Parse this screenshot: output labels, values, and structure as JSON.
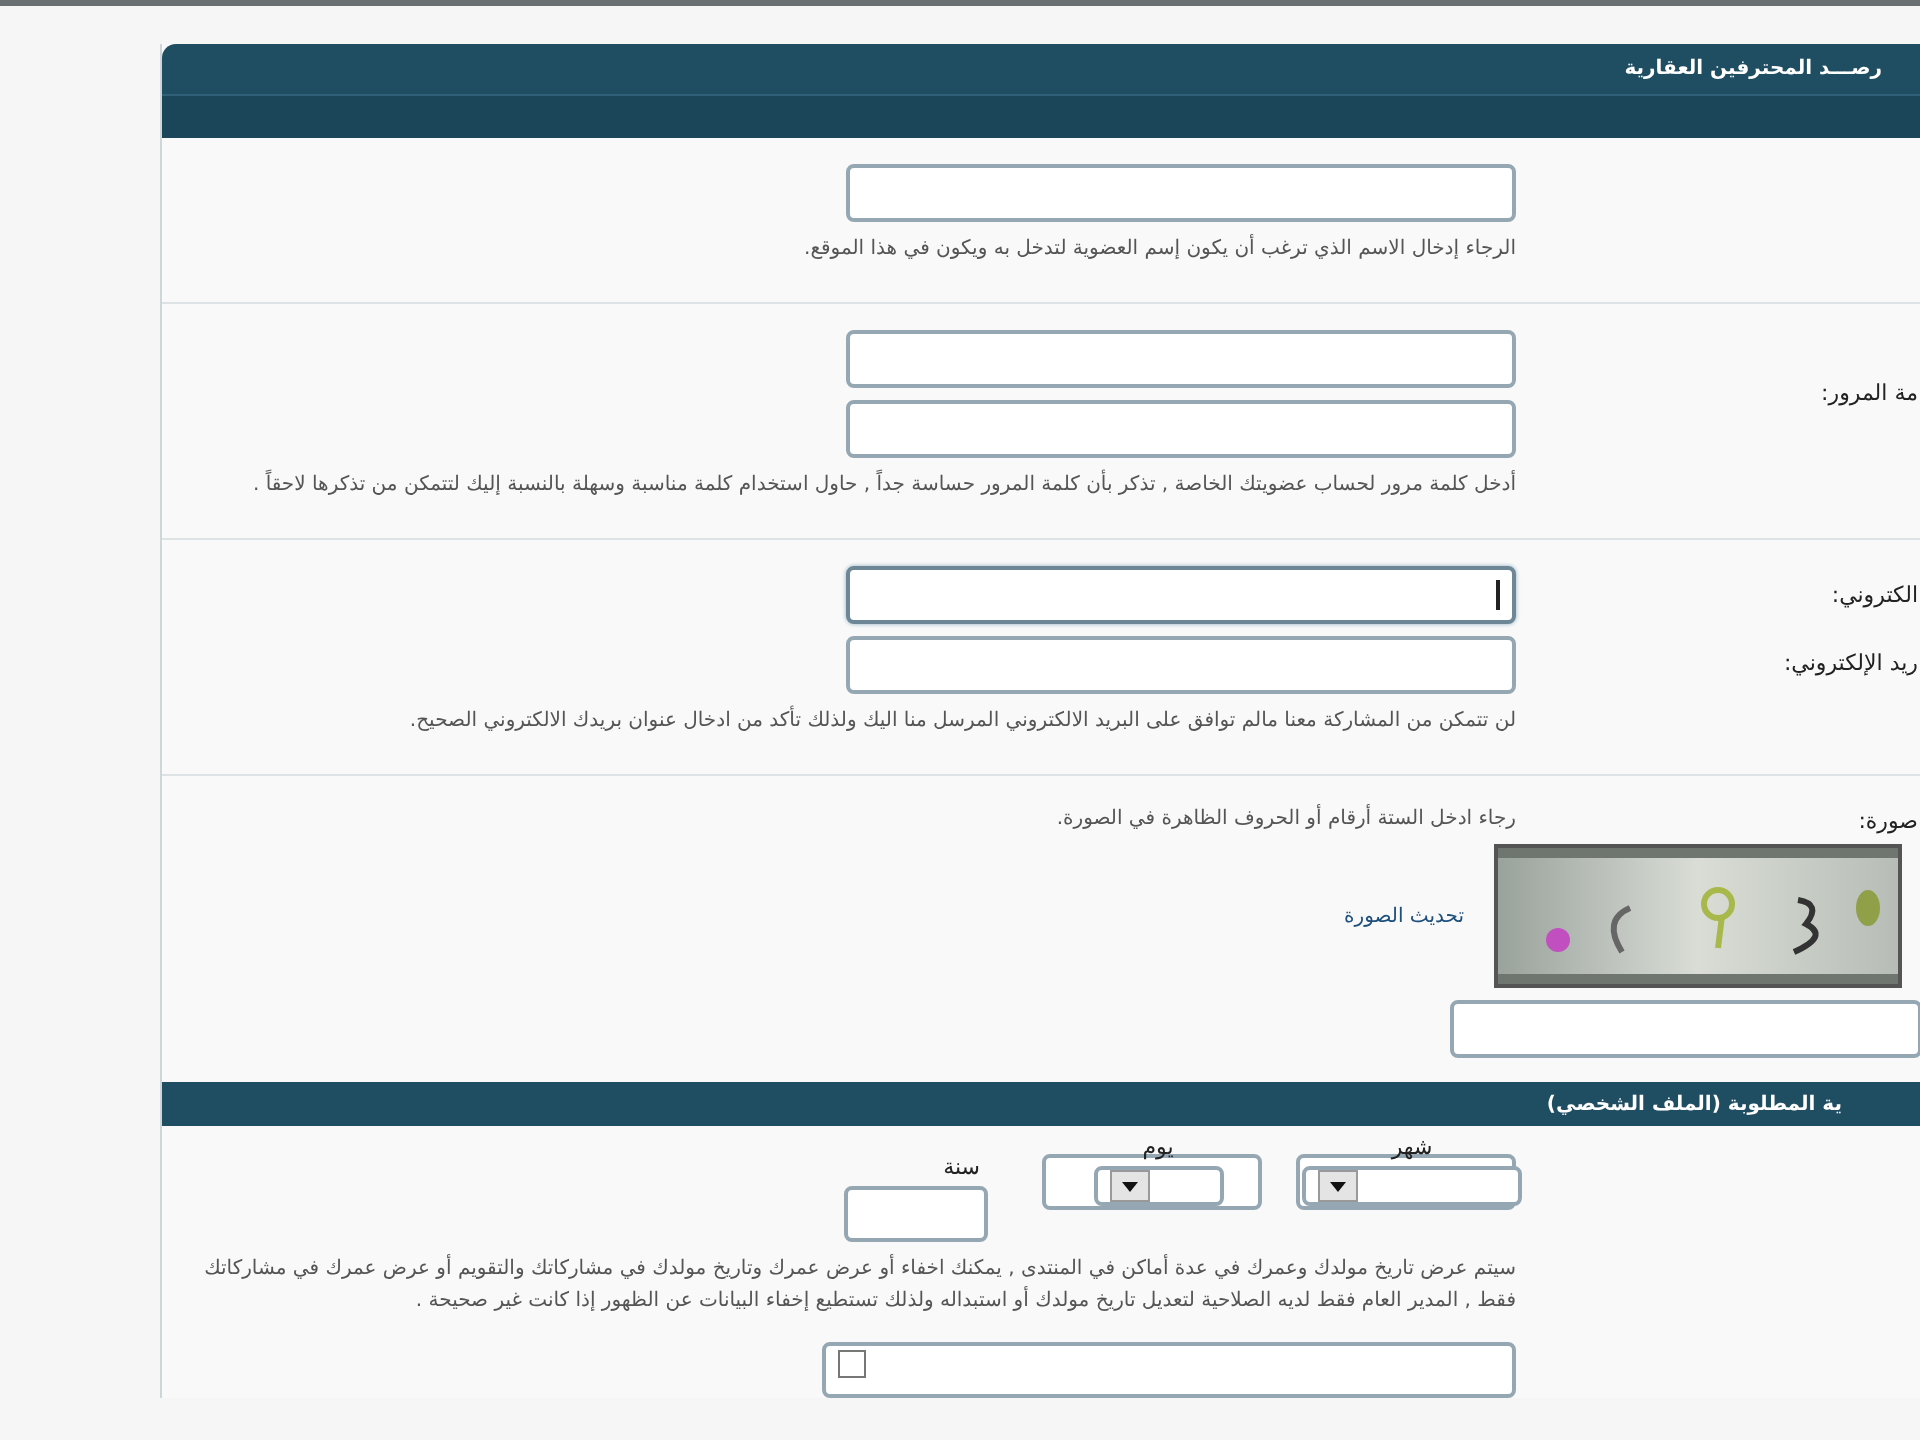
{
  "panel": {
    "title": "رصـــد المحترفين العقارية"
  },
  "rows": [
    {
      "kind": "fields",
      "inputs": [
        {
          "focused": false
        }
      ],
      "hint": "الرجاء إدخال الاسم الذي ترغب أن يكون إسم العضوية لتدخل به ويكون في هذا الموقع."
    },
    {
      "kind": "fields",
      "label": "مة المرور:",
      "inputs": [
        {
          "focused": false
        },
        {
          "focused": false
        }
      ],
      "hint": "أدخل كلمة مرور لحساب عضويتك الخاصة , تذكر بأن كلمة المرور حساسة جداً , حاول استخدام كلمة مناسبة وسهلة بالنسبة إليك لتتمكن من تذكرها لاحقاً ."
    },
    {
      "kind": "fields",
      "inputs": [
        {
          "label": "الكتروني:",
          "focused": true
        },
        {
          "label": "ريد الإلكتروني:",
          "focused": false
        }
      ],
      "hint": "لن تتمكن من المشاركة معنا مالم توافق على البريد الالكتروني المرسل منا اليك ولذلك تأكد من ادخال عنوان بريدك الالكتروني الصحيح."
    },
    {
      "kind": "captcha",
      "label": "صورة:",
      "hint": "رجاء ادخل الستة أرقام أو الحروف الظاهرة في الصورة.",
      "refresh_link": "تحديث الصورة"
    }
  ],
  "section": {
    "title": "ية المطلوبة (الملف الشخصي)"
  },
  "birthday": {
    "parts": [
      {
        "kind": "select",
        "label": "شهر"
      },
      {
        "kind": "select",
        "label": "يوم"
      },
      {
        "kind": "text",
        "label": "سنة"
      }
    ],
    "hint": "سيتم عرض تاريخ مولدك وعمرك في عدة أماكن في المنتدى , يمكنك اخفاء أو عرض عمرك وتاريخ مولدك في مشاركاتك والتقويم أو عرض عمرك في مشاركاتك فقط , المدير العام فقط لديه الصلاحية لتعديل تاريخ مولدك أو استبداله ولذلك تستطيع إخفاء البيانات عن الظهور إذا كانت غير صحيحة .",
    "option": {
      "checked": false
    }
  }
}
